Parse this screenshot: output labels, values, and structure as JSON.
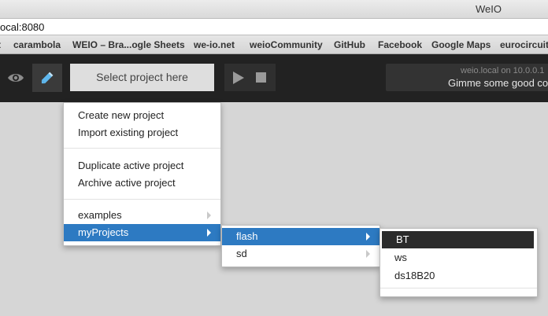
{
  "window": {
    "title": "WeIO"
  },
  "address_bar": {
    "url": "ocal:8080"
  },
  "bookmarks": [
    {
      "label": "t"
    },
    {
      "label": "carambola"
    },
    {
      "label": "WEIO – Bra...ogle Sheets"
    },
    {
      "label": "we-io.net"
    },
    {
      "label": "weioCommunity"
    },
    {
      "label": "GitHub"
    },
    {
      "label": "Facebook"
    },
    {
      "label": "Google Maps"
    },
    {
      "label": "eurocircuit"
    }
  ],
  "toolbar": {
    "preview_icon": "eye-icon",
    "editor_icon": "pencil-icon",
    "project_selector_label": "Select project here",
    "play_icon": "play-icon",
    "stop_icon": "stop-icon",
    "status_host": "weio.local on 10.0.0.1",
    "status_message": "Gimme some good cod"
  },
  "menu_main": {
    "items": [
      {
        "label": "Create new project"
      },
      {
        "label": "Import existing project"
      },
      {
        "label": "Duplicate active project"
      },
      {
        "label": "Archive active project"
      },
      {
        "label": "examples"
      },
      {
        "label": "myProjects"
      }
    ]
  },
  "menu_sub": {
    "items": [
      {
        "label": "flash"
      },
      {
        "label": "sd"
      }
    ]
  },
  "menu_sub2": {
    "items": [
      {
        "label": "BT"
      },
      {
        "label": "ws"
      },
      {
        "label": "ds18B20"
      }
    ]
  },
  "colors": {
    "accent_blue": "#2d7ac2",
    "toolbar_bg": "#222222",
    "highlight_dark": "#2b2b2b"
  }
}
